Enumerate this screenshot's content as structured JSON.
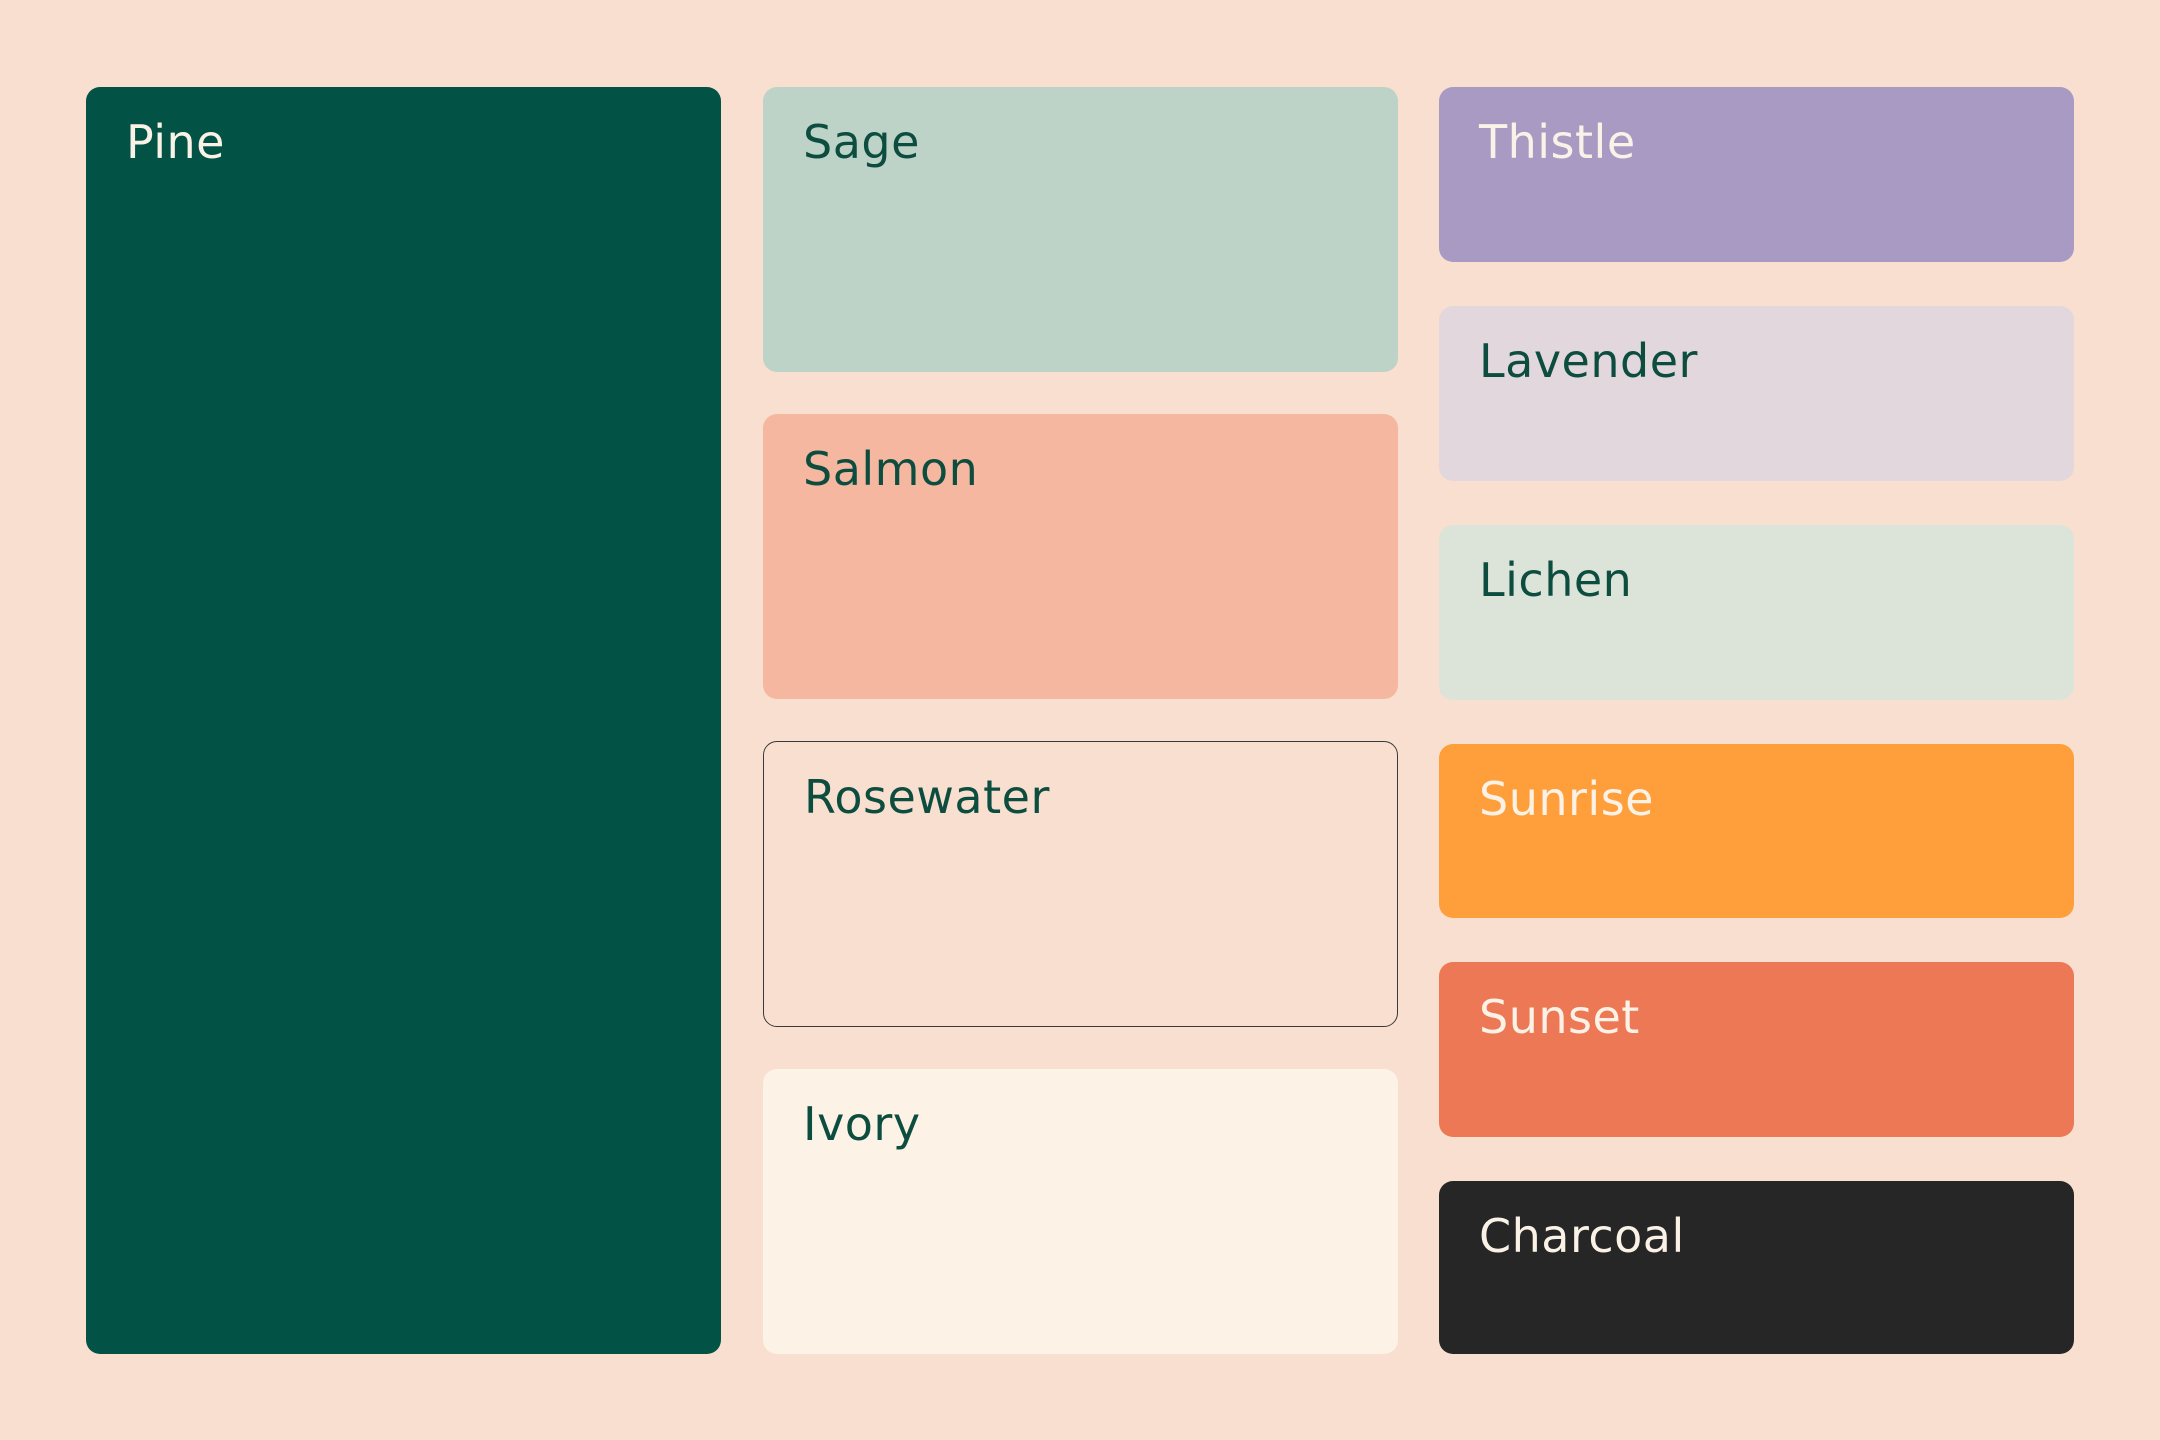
{
  "swatches": {
    "pine": {
      "label": "Pine",
      "color": "#025345"
    },
    "sage": {
      "label": "Sage",
      "color": "#BDD3C7"
    },
    "salmon": {
      "label": "Salmon",
      "color": "#F5B7A0"
    },
    "rosewater": {
      "label": "Rosewater",
      "color": "#F9DFCF"
    },
    "ivory": {
      "label": "Ivory",
      "color": "#FCF3E6"
    },
    "thistle": {
      "label": "Thistle",
      "color": "#A99AC4"
    },
    "lavender": {
      "label": "Lavender",
      "color": "#E1D7DD"
    },
    "lichen": {
      "label": "Lichen",
      "color": "#DCE3D9"
    },
    "sunrise": {
      "label": "Sunrise",
      "color": "#FF9F3B"
    },
    "sunset": {
      "label": "Sunset",
      "color": "#ED7855"
    },
    "charcoal": {
      "label": "Charcoal",
      "color": "#262626"
    }
  },
  "page": {
    "background": "#F9DFCF"
  }
}
